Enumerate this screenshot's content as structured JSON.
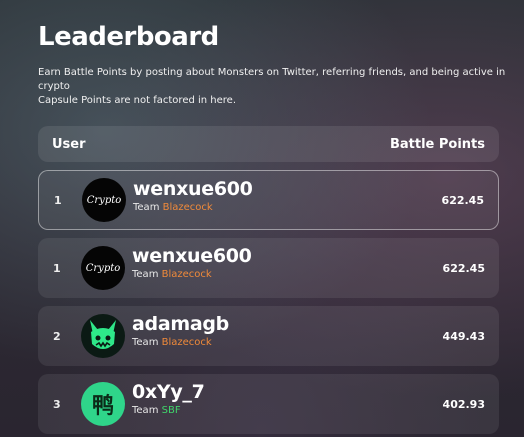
{
  "title": "Leaderboard",
  "description": {
    "line1": "Earn Battle Points by posting about Monsters on Twitter, referring friends, and being active in crypto",
    "line2": "Capsule Points are not factored in here."
  },
  "header": {
    "user_label": "User",
    "points_label": "Battle Points"
  },
  "team_prefix": "Team",
  "rows": [
    {
      "rank": "1",
      "avatar": "Crypto",
      "username": "wenxue600",
      "team": "Blazecock",
      "points": "622.45",
      "team_color": "#f08a3a"
    },
    {
      "rank": "1",
      "avatar": "Crypto",
      "username": "wenxue600",
      "team": "Blazecock",
      "points": "622.45",
      "team_color": "#f08a3a"
    },
    {
      "rank": "2",
      "avatar": "fox-icon",
      "username": "adamagb",
      "team": "Blazecock",
      "points": "449.43",
      "team_color": "#f08a3a"
    },
    {
      "rank": "3",
      "avatar": "鸭",
      "username": "0xYy_7",
      "team": "SBF",
      "points": "402.93",
      "team_color": "#3fd46a"
    }
  ]
}
